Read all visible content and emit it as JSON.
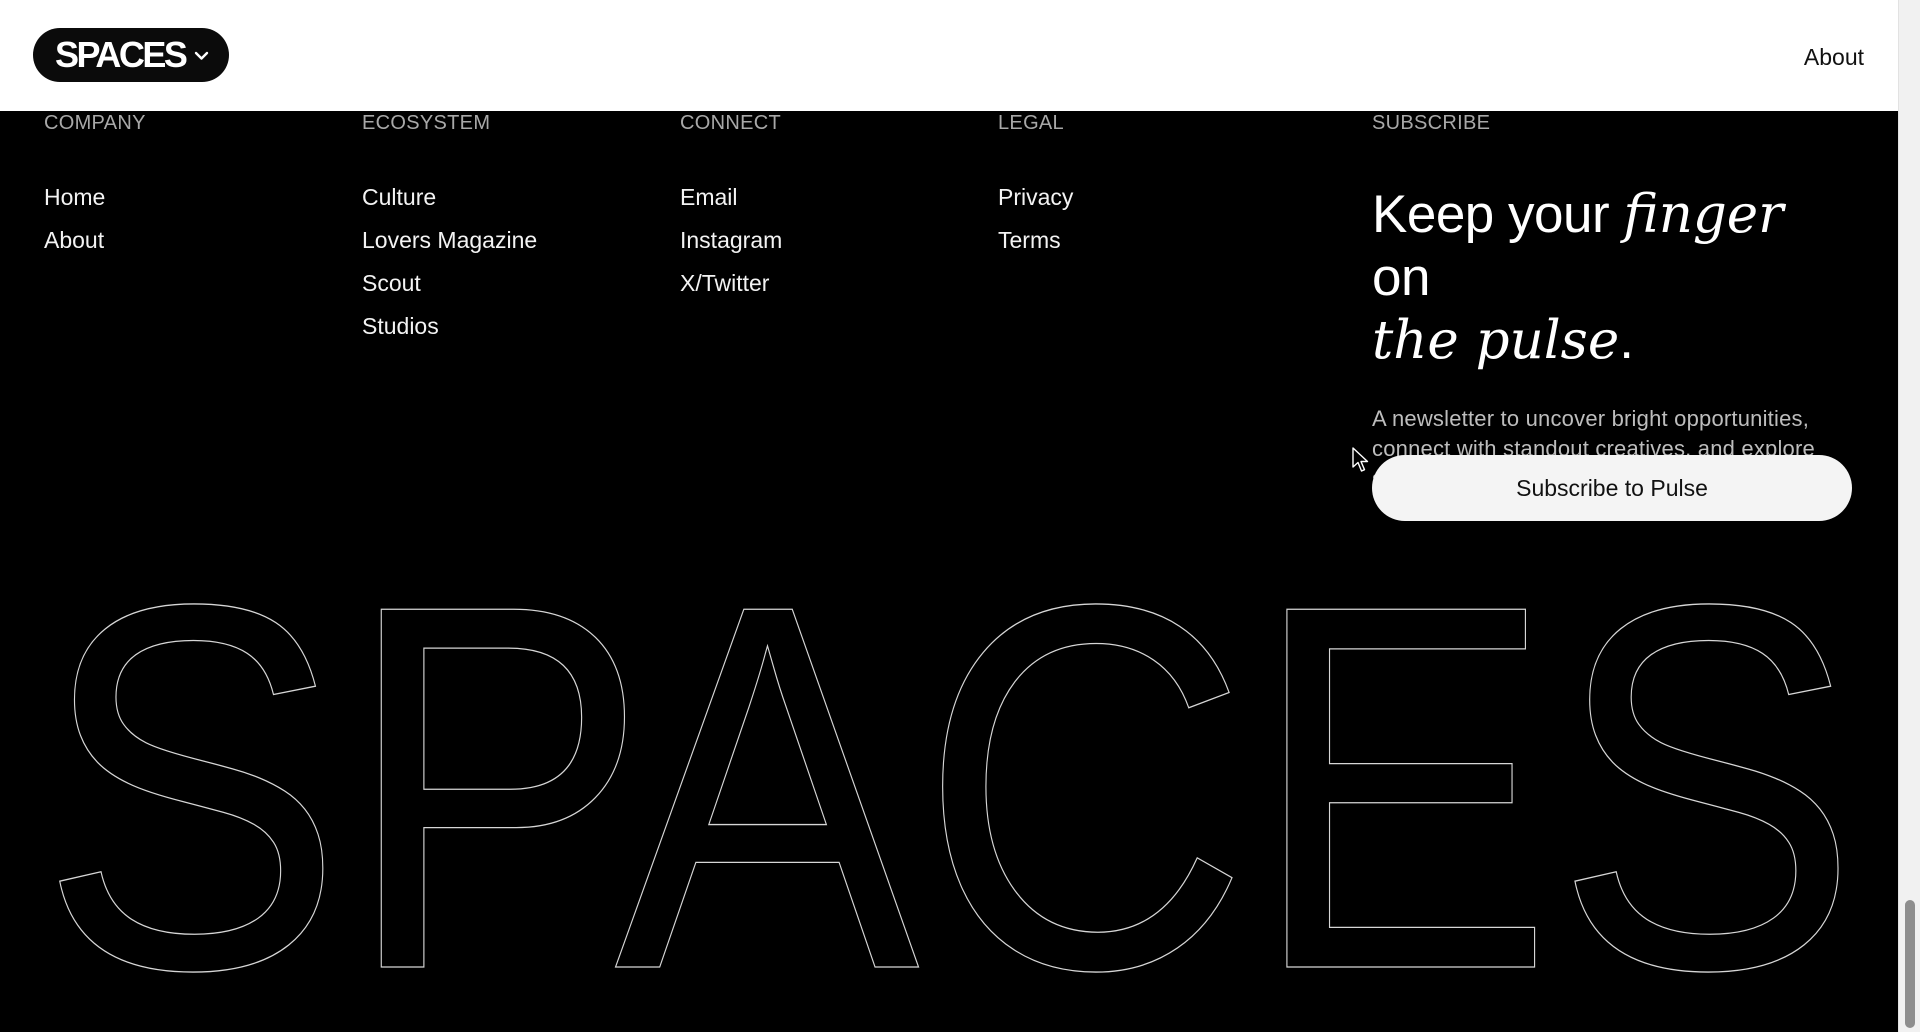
{
  "header": {
    "brand": "SPACES",
    "about_link": "About"
  },
  "footer": {
    "columns": [
      {
        "heading": "COMPANY",
        "links": [
          "Home",
          "About"
        ]
      },
      {
        "heading": "ECOSYSTEM",
        "links": [
          "Culture",
          "Lovers Magazine",
          "Scout",
          "Studios"
        ]
      },
      {
        "heading": "CONNECT",
        "links": [
          "Email",
          "Instagram",
          "X/Twitter"
        ]
      },
      {
        "heading": "LEGAL",
        "links": [
          "Privacy",
          "Terms"
        ]
      }
    ],
    "subscribe": {
      "heading": "SUBSCRIBE",
      "title_part1": "Keep your ",
      "title_italic1": "finger",
      "title_part2": " on",
      "title_italic2": "the pulse",
      "title_end": ".",
      "description": "A newsletter to uncover bright opportunities, connect with standout creatives, and explore stories shaping culture, design, and tech.",
      "button_label": "Subscribe to Pulse"
    },
    "wordmark": "SPACES"
  },
  "colors": {
    "background": "#000000",
    "header_bg": "#ffffff",
    "pill_bg": "#0b0b0b",
    "button_bg": "#f4f4f4"
  }
}
